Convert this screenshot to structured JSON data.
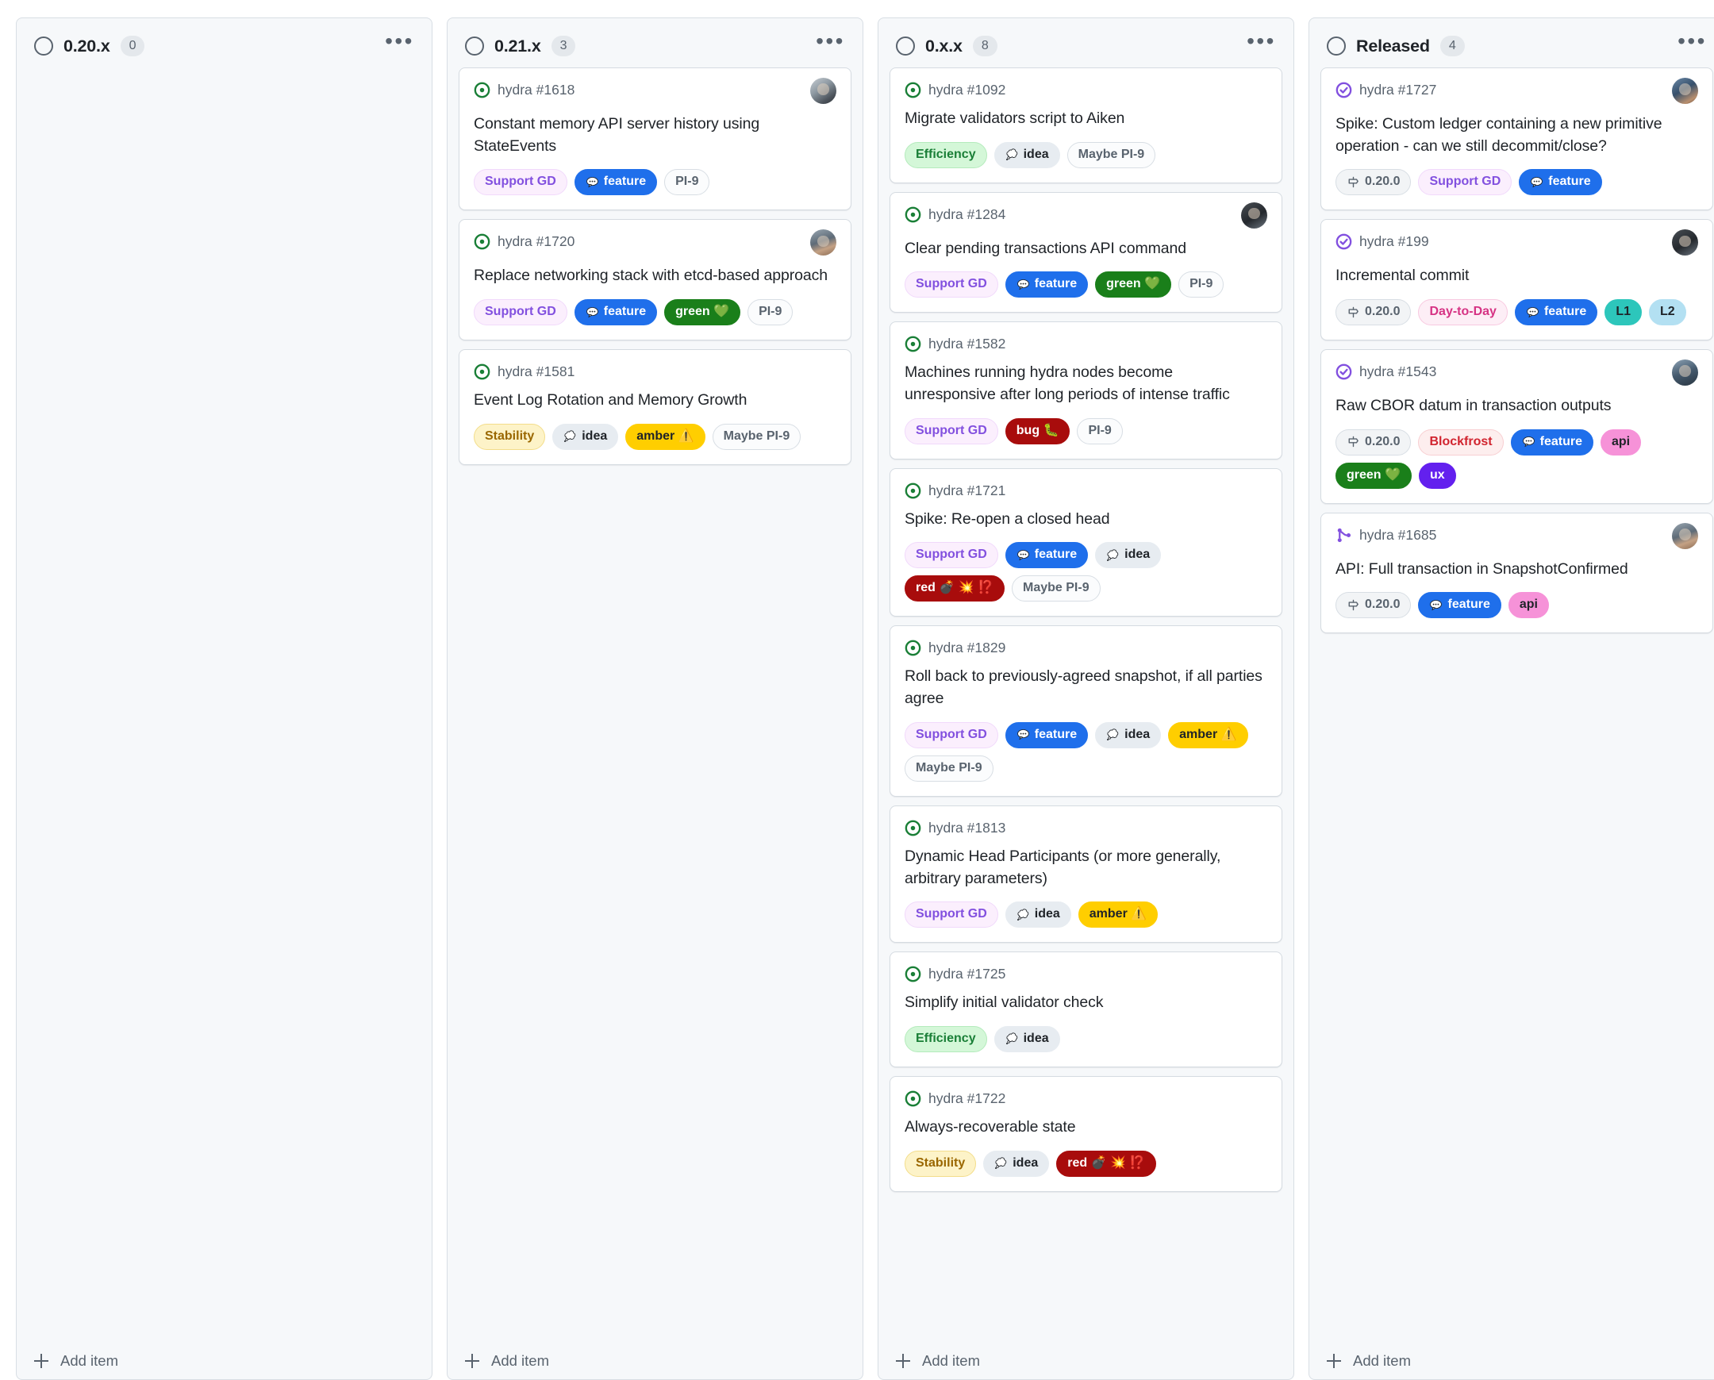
{
  "board": {
    "add_item_label": "Add item",
    "menu_glyph": "•••"
  },
  "columns": [
    {
      "id": "col-020x",
      "title": "0.20.x",
      "count": "0",
      "cards": []
    },
    {
      "id": "col-021x",
      "title": "0.21.x",
      "count": "3",
      "cards": [
        {
          "ref": "hydra #1618",
          "state": "open-issue",
          "title": "Constant memory API server history using StateEvents",
          "avatar": "av-a",
          "labels": [
            {
              "text": "Support GD",
              "style": "support-gd"
            },
            {
              "text": "feature",
              "style": "feature",
              "icon": "speech-bubble"
            },
            {
              "text": "PI-9",
              "style": "plain"
            }
          ]
        },
        {
          "ref": "hydra #1720",
          "state": "open-issue",
          "title": "Replace networking stack with etcd-based approach",
          "avatar": "av-b",
          "labels": [
            {
              "text": "Support GD",
              "style": "support-gd"
            },
            {
              "text": "feature",
              "style": "feature",
              "icon": "speech-bubble"
            },
            {
              "text": "green 💚",
              "style": "green"
            },
            {
              "text": "PI-9",
              "style": "plain"
            }
          ]
        },
        {
          "ref": "hydra #1581",
          "state": "open-issue",
          "title": "Event Log Rotation and Memory Growth",
          "avatar": null,
          "labels": [
            {
              "text": "Stability",
              "style": "stability"
            },
            {
              "text": "idea",
              "style": "idea",
              "icon": "thought-bubble"
            },
            {
              "text": "amber ⚠️",
              "style": "amber"
            },
            {
              "text": "Maybe PI-9",
              "style": "plain"
            }
          ]
        }
      ]
    },
    {
      "id": "col-0xx",
      "title": "0.x.x",
      "count": "8",
      "cards": [
        {
          "ref": "hydra #1092",
          "state": "open-issue",
          "title": "Migrate validators script to Aiken",
          "avatar": null,
          "labels": [
            {
              "text": "Efficiency",
              "style": "efficiency"
            },
            {
              "text": "idea",
              "style": "idea",
              "icon": "thought-bubble"
            },
            {
              "text": "Maybe PI-9",
              "style": "plain"
            }
          ]
        },
        {
          "ref": "hydra #1284",
          "state": "open-issue",
          "title": "Clear pending transactions API command",
          "avatar": "av-c",
          "labels": [
            {
              "text": "Support GD",
              "style": "support-gd"
            },
            {
              "text": "feature",
              "style": "feature",
              "icon": "speech-bubble"
            },
            {
              "text": "green 💚",
              "style": "green"
            },
            {
              "text": "PI-9",
              "style": "plain"
            }
          ]
        },
        {
          "ref": "hydra #1582",
          "state": "open-issue",
          "title": "Machines running hydra nodes become unresponsive after long periods of intense traffic",
          "avatar": null,
          "labels": [
            {
              "text": "Support GD",
              "style": "support-gd"
            },
            {
              "text": "bug 🐛",
              "style": "bug"
            },
            {
              "text": "PI-9",
              "style": "plain"
            }
          ]
        },
        {
          "ref": "hydra #1721",
          "state": "open-issue",
          "title": "Spike: Re-open a closed head",
          "avatar": null,
          "labels": [
            {
              "text": "Support GD",
              "style": "support-gd"
            },
            {
              "text": "feature",
              "style": "feature",
              "icon": "speech-bubble"
            },
            {
              "text": "idea",
              "style": "idea",
              "icon": "thought-bubble"
            },
            {
              "text": "red 💣 💥 ⁉️",
              "style": "red"
            },
            {
              "text": "Maybe PI-9",
              "style": "plain"
            }
          ]
        },
        {
          "ref": "hydra #1829",
          "state": "open-issue",
          "title": "Roll back to previously-agreed snapshot, if all parties agree",
          "avatar": null,
          "labels": [
            {
              "text": "Support GD",
              "style": "support-gd"
            },
            {
              "text": "feature",
              "style": "feature",
              "icon": "speech-bubble"
            },
            {
              "text": "idea",
              "style": "idea",
              "icon": "thought-bubble"
            },
            {
              "text": "amber ⚠️",
              "style": "amber"
            },
            {
              "text": "Maybe PI-9",
              "style": "plain"
            }
          ]
        },
        {
          "ref": "hydra #1813",
          "state": "open-issue",
          "title": "Dynamic Head Participants (or more generally, arbitrary parameters)",
          "avatar": null,
          "labels": [
            {
              "text": "Support GD",
              "style": "support-gd"
            },
            {
              "text": "idea",
              "style": "idea",
              "icon": "thought-bubble"
            },
            {
              "text": "amber ⚠️",
              "style": "amber"
            }
          ]
        },
        {
          "ref": "hydra #1725",
          "state": "open-issue",
          "title": "Simplify initial validator check",
          "avatar": null,
          "labels": [
            {
              "text": "Efficiency",
              "style": "efficiency"
            },
            {
              "text": "idea",
              "style": "idea",
              "icon": "thought-bubble"
            }
          ]
        },
        {
          "ref": "hydra #1722",
          "state": "open-issue",
          "title": "Always-recoverable state",
          "avatar": null,
          "labels": [
            {
              "text": "Stability",
              "style": "stability"
            },
            {
              "text": "idea",
              "style": "idea",
              "icon": "thought-bubble"
            },
            {
              "text": "red 💣 💥 ⁉️",
              "style": "red"
            }
          ]
        }
      ]
    },
    {
      "id": "col-released",
      "title": "Released",
      "count": "4",
      "cards": [
        {
          "ref": "hydra #1727",
          "state": "closed-issue",
          "title": "Spike: Custom ledger containing a new primitive operation - can we still decommit/close?",
          "avatar": "av-d",
          "labels": [
            {
              "text": "0.20.0",
              "style": "milestone",
              "icon": "milestone"
            },
            {
              "text": "Support GD",
              "style": "support-gd"
            },
            {
              "text": "feature",
              "style": "feature",
              "icon": "speech-bubble"
            }
          ]
        },
        {
          "ref": "hydra #199",
          "state": "closed-issue",
          "title": "Incremental commit",
          "avatar": "av-c",
          "labels": [
            {
              "text": "0.20.0",
              "style": "milestone",
              "icon": "milestone"
            },
            {
              "text": "Day-to-Day",
              "style": "day-to-day"
            },
            {
              "text": "feature",
              "style": "feature",
              "icon": "speech-bubble"
            },
            {
              "text": "L1",
              "style": "l1"
            },
            {
              "text": "L2",
              "style": "l2"
            }
          ]
        },
        {
          "ref": "hydra #1543",
          "state": "closed-issue",
          "title": "Raw CBOR datum in transaction outputs",
          "avatar": "av-e",
          "labels": [
            {
              "text": "0.20.0",
              "style": "milestone",
              "icon": "milestone"
            },
            {
              "text": "Blockfrost",
              "style": "blockfrost"
            },
            {
              "text": "feature",
              "style": "feature",
              "icon": "speech-bubble"
            },
            {
              "text": "api",
              "style": "api"
            },
            {
              "text": "green 💚",
              "style": "green"
            },
            {
              "text": "ux",
              "style": "ux"
            }
          ]
        },
        {
          "ref": "hydra #1685",
          "state": "merged-pr",
          "title": "API: Full transaction in SnapshotConfirmed",
          "avatar": "av-b",
          "labels": [
            {
              "text": "0.20.0",
              "style": "milestone",
              "icon": "milestone"
            },
            {
              "text": "feature",
              "style": "feature",
              "icon": "speech-bubble"
            },
            {
              "text": "api",
              "style": "api"
            }
          ]
        }
      ]
    }
  ],
  "label_colors": {
    "support-gd": {
      "bg": "#fbeffd",
      "fg": "#8250df",
      "border": "#f1d9fb"
    },
    "feature": {
      "bg": "#1f6feb",
      "fg": "#ffffff",
      "border": "#1f6feb"
    },
    "plain": {
      "bg": "#fbfcfd",
      "fg": "#59636e",
      "border": "#d8dee4"
    },
    "green": {
      "bg": "#1a7f1a",
      "fg": "#ffffff",
      "border": "#1a7f1a"
    },
    "stability": {
      "bg": "#fdf3c8",
      "fg": "#9a6700",
      "border": "#f3dd8a"
    },
    "idea": {
      "bg": "#e7ecf1",
      "fg": "#1f2328",
      "border": "#e7ecf1"
    },
    "amber": {
      "bg": "#ffce00",
      "fg": "#1f2328",
      "border": "#ffce00"
    },
    "efficiency": {
      "bg": "#d4f7d8",
      "fg": "#1a7f37",
      "border": "#b4ebbc"
    },
    "bug": {
      "bg": "#a80c0c",
      "fg": "#ffffff",
      "border": "#a80c0c"
    },
    "red": {
      "bg": "#a80c0c",
      "fg": "#ffffff",
      "border": "#a80c0c"
    },
    "milestone": {
      "bg": "#f2f4f6",
      "fg": "#59636e",
      "border": "#d8dee4"
    },
    "day-to-day": {
      "bg": "#fdeef6",
      "fg": "#d63384",
      "border": "#f8c9e0"
    },
    "l1": {
      "bg": "#2dc6bb",
      "fg": "#1f2328",
      "border": "#2dc6bb"
    },
    "l2": {
      "bg": "#b3e0f2",
      "fg": "#1f2328",
      "border": "#b3e0f2"
    },
    "blockfrost": {
      "bg": "#fdeeee",
      "fg": "#d1242f",
      "border": "#f8cfd2"
    },
    "api": {
      "bg": "#f692d8",
      "fg": "#1f2328",
      "border": "#f692d8"
    },
    "ux": {
      "bg": "#6320ee",
      "fg": "#ffffff",
      "border": "#6320ee"
    }
  }
}
